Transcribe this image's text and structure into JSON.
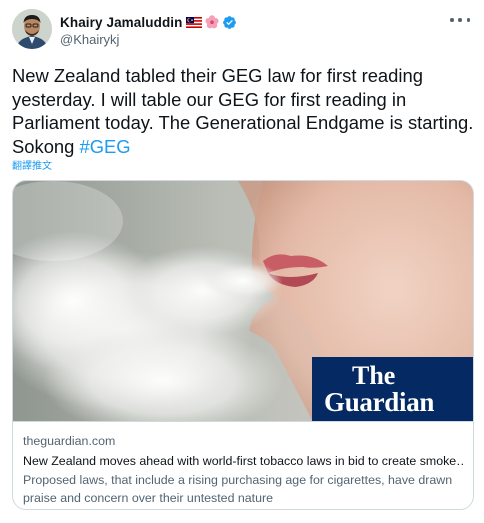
{
  "author": {
    "display_name": "Khairy Jamaluddin",
    "handle": "@Khairykj",
    "verified": true,
    "badges": [
      "malaysia-flag-icon",
      "hibiscus-icon",
      "verified-badge-icon"
    ]
  },
  "menu": {
    "icon": "more-horizontal-icon"
  },
  "tweet": {
    "text": "New Zealand tabled their GEG law for first reading yesterday. I will table our GEG for first reading in Parliament today. The Generational Endgame is starting. Sokong ",
    "hashtag": "#GEG",
    "translate_label": "翻譯推文"
  },
  "card": {
    "image_logo_line1": "The",
    "image_logo_line2": "Guardian",
    "domain": "theguardian.com",
    "headline": "New Zealand moves ahead with world-first tobacco laws in bid to create smoke…",
    "description": "Proposed laws, that include a rising purchasing age for cigarettes, have drawn praise and concern over their untested nature"
  },
  "colors": {
    "accent": "#1d9bf0",
    "text": "#0f1419",
    "secondary": "#536471",
    "border": "#cfd9de",
    "guardian_blue": "#052962"
  }
}
